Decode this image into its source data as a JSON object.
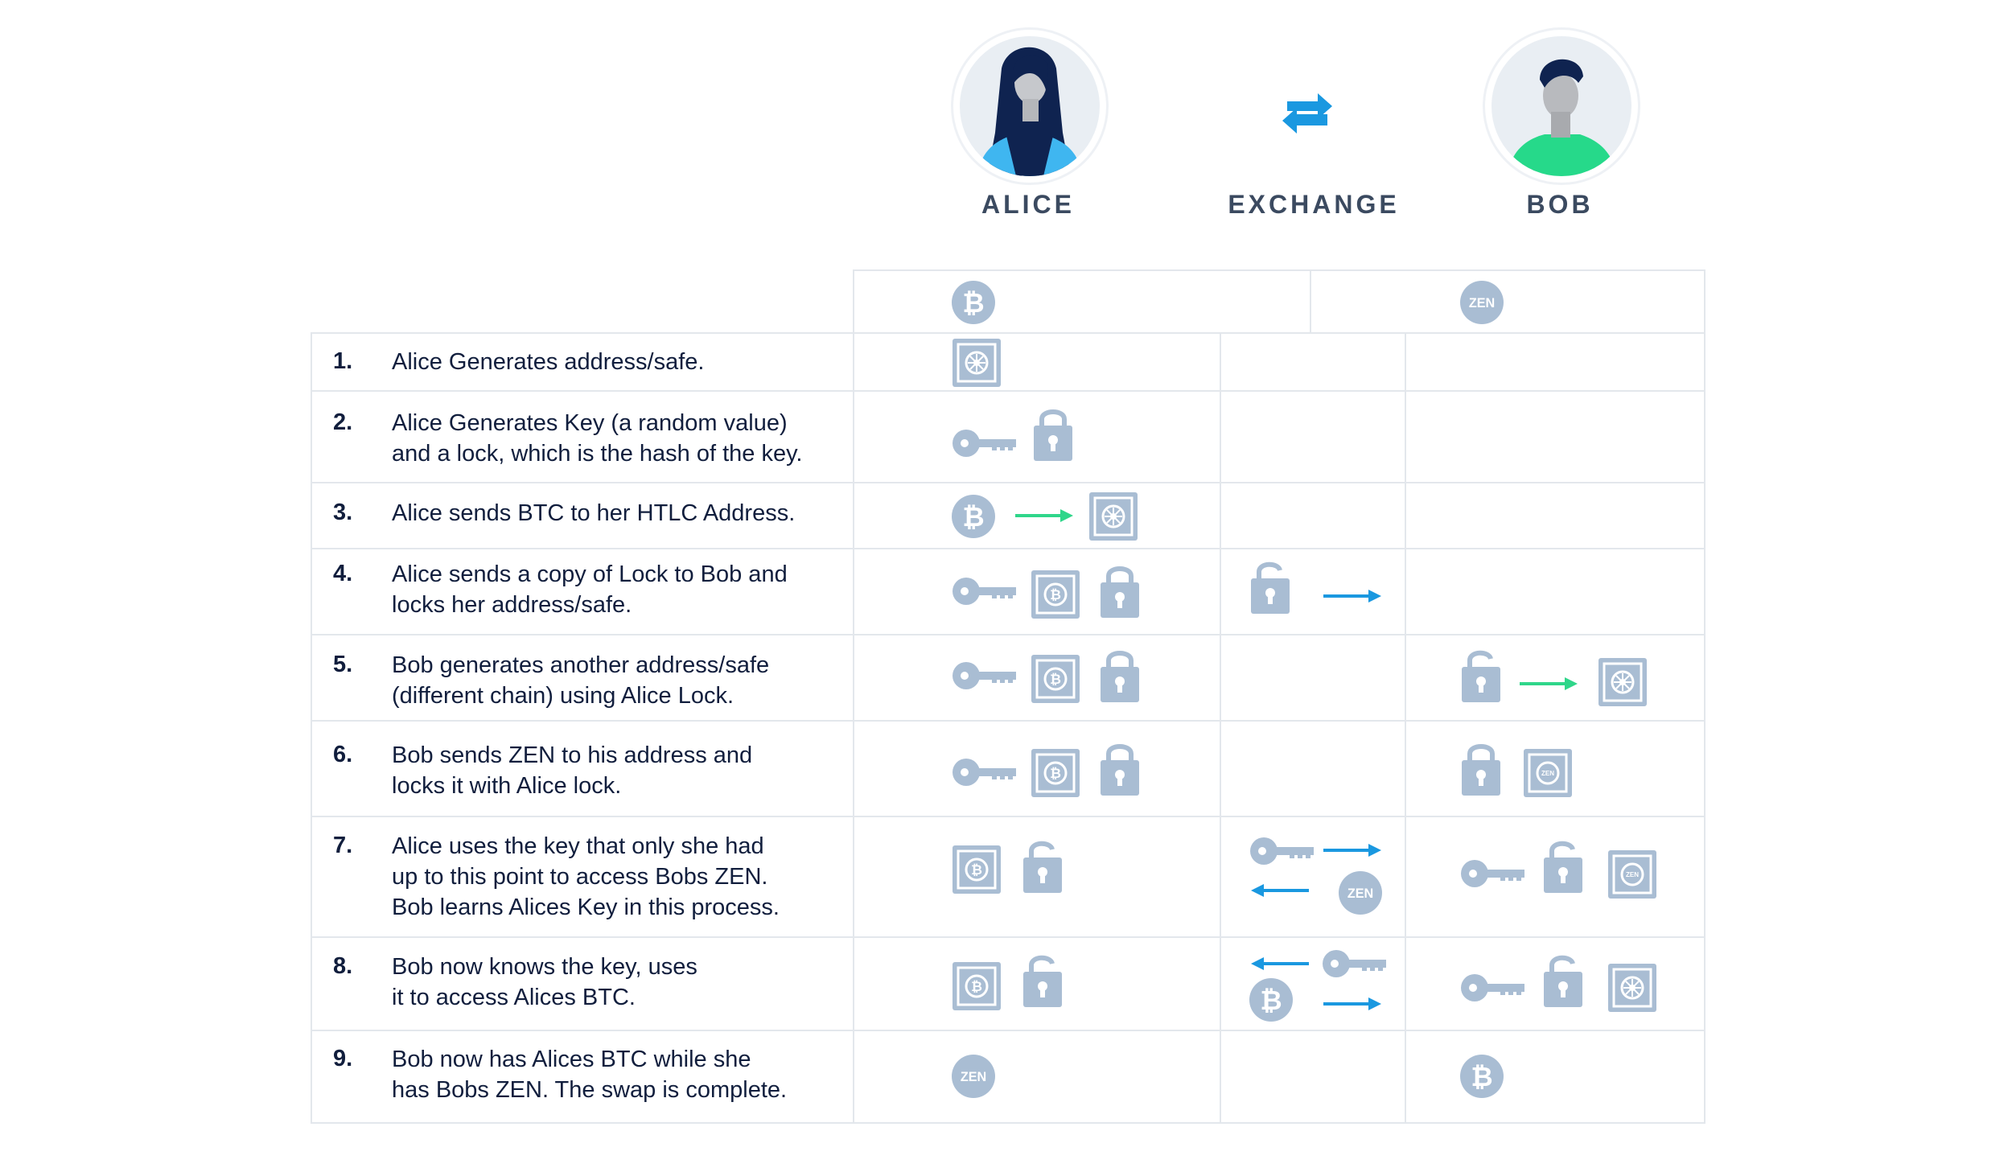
{
  "participants": {
    "alice": "ALICE",
    "exchange": "EXCHANGE",
    "bob": "BOB"
  },
  "columns": {
    "left_coin": "BTC",
    "right_coin": "ZEN"
  },
  "steps": [
    {
      "num": "1.",
      "lines": [
        "Alice Generates address/safe."
      ]
    },
    {
      "num": "2.",
      "lines": [
        "Alice Generates Key (a random value)",
        "and a lock, which is the hash of the key."
      ]
    },
    {
      "num": "3.",
      "lines": [
        "Alice sends BTC to her HTLC Address."
      ]
    },
    {
      "num": "4.",
      "lines": [
        "Alice sends a copy of Lock to Bob and",
        "locks her address/safe."
      ]
    },
    {
      "num": "5.",
      "lines": [
        "Bob generates another address/safe",
        "(different chain) using Alice Lock."
      ]
    },
    {
      "num": "6.",
      "lines": [
        "Bob sends ZEN to his address and",
        "locks it with Alice lock."
      ]
    },
    {
      "num": "7.",
      "lines": [
        "Alice uses the key that only she had",
        "up to this point to access Bobs ZEN.",
        "Bob learns Alices Key in this process."
      ]
    },
    {
      "num": "8.",
      "lines": [
        "Bob now knows the key, uses",
        "it to access Alices BTC."
      ]
    },
    {
      "num": "9.",
      "lines": [
        "Bob now has Alices BTC while she",
        "has Bobs ZEN. The swap is complete."
      ]
    }
  ],
  "coin_labels": {
    "btc": "₿",
    "zen": "ZEN"
  },
  "colors": {
    "icon": "#a9bdd3",
    "icon_dark": "#8fa6c0",
    "arrow_green": "#2fd68a",
    "arrow_blue": "#1a98e0",
    "text": "#111e3d"
  },
  "icons": [
    "exchange-arrows-icon",
    "btc-coin-icon",
    "zen-coin-icon",
    "key-icon",
    "lock-icon",
    "unlock-icon",
    "safe-icon",
    "btc-safe-icon",
    "zen-safe-icon"
  ]
}
